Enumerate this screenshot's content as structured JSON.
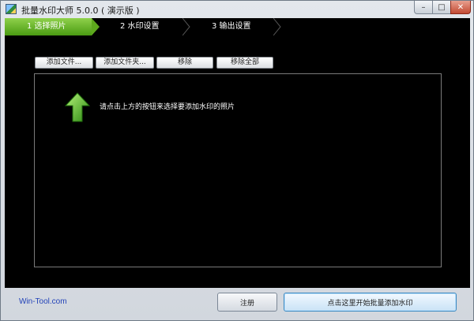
{
  "window": {
    "title": "批量水印大师 5.0.0 ( 演示版 )",
    "controls": {
      "minimize": "–",
      "maximize": "□",
      "close": "✕"
    }
  },
  "steps": [
    {
      "label": "1 选择照片",
      "active": true
    },
    {
      "label": "2 水印设置",
      "active": false
    },
    {
      "label": "3 输出设置",
      "active": false
    }
  ],
  "toolbar": {
    "add_file": "添加文件...",
    "add_folder": "添加文件夹...",
    "remove": "移除",
    "remove_all": "移除全部"
  },
  "drop_area": {
    "hint": "请点击上方的按钮来选择要添加水印的照片",
    "icon": "green-up-arrow-icon"
  },
  "footer": {
    "site": "Win-Tool.com",
    "register": "注册",
    "start": "点击这里开始批量添加水印"
  },
  "colors": {
    "accent_green": "#5ea91d",
    "background": "#000000",
    "link": "#2343b8",
    "primary_button_border": "#3c8ac2"
  }
}
